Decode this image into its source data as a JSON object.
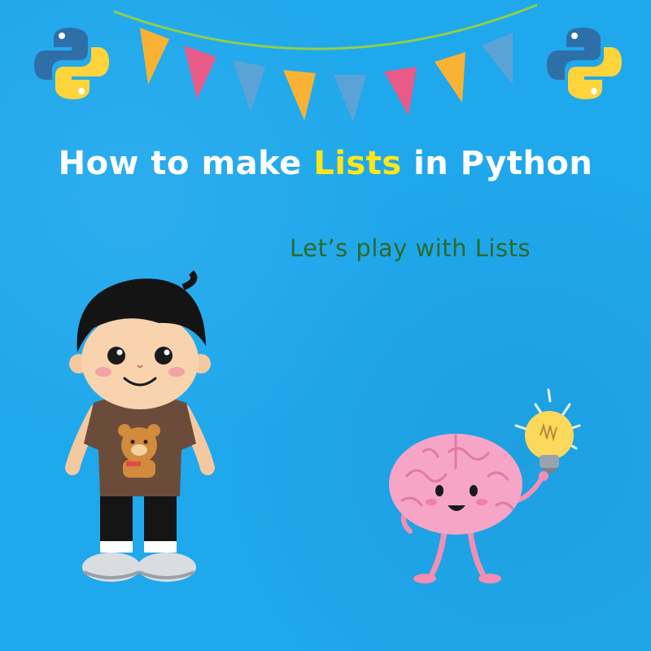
{
  "title": {
    "prefix": "How to make ",
    "highlight": "Lists",
    "suffix": " in Python"
  },
  "subtitle": "Let’s play with Lists",
  "colors": {
    "background": "#1fa8ec",
    "title": "#ffffff",
    "highlight": "#ffe61b",
    "subtitle": "#2c6a2c"
  },
  "icons": [
    "python-logo-left",
    "python-logo-right",
    "bunting-flags",
    "boy-illustration",
    "brain-with-lightbulb"
  ]
}
